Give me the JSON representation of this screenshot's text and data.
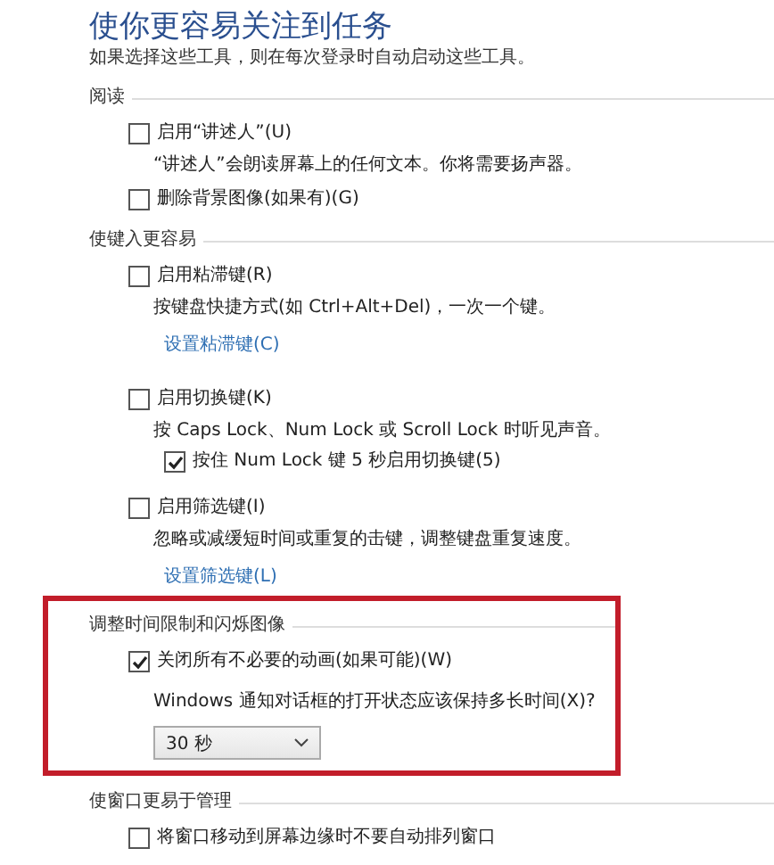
{
  "header": {
    "title": "使你更容易关注到任务",
    "subtitle": "如果选择这些工具，则在每次登录时自动启动这些工具。"
  },
  "sections": [
    {
      "heading": "阅读",
      "highlighted": false,
      "items": [
        {
          "kind": "checkbox",
          "label": "启用“讲述人”(U)",
          "checked": false
        },
        {
          "kind": "description",
          "text": "“讲述人”会朗读屏幕上的任何文本。你将需要扬声器。"
        },
        {
          "kind": "checkbox",
          "label": "删除背景图像(如果有)(G)",
          "checked": false
        }
      ]
    },
    {
      "heading": "使键入更容易",
      "highlighted": false,
      "items": [
        {
          "kind": "checkbox",
          "label": "启用粘滞键(R)",
          "checked": false
        },
        {
          "kind": "description",
          "text": "按键盘快捷方式(如 Ctrl+Alt+Del)，一次一个键。"
        },
        {
          "kind": "link",
          "text": "设置粘滞键(C)"
        },
        {
          "kind": "checkbox",
          "label": "启用切换键(K)",
          "checked": false
        },
        {
          "kind": "description",
          "text": "按 Caps Lock、Num Lock 或 Scroll Lock 时听见声音。"
        },
        {
          "kind": "subcheckbox",
          "label": "按住 Num Lock 键 5 秒启用切换键(5)",
          "checked": true
        },
        {
          "kind": "checkbox",
          "label": "启用筛选键(I)",
          "checked": false
        },
        {
          "kind": "description",
          "text": "忽略或减缓短时间或重复的击键，调整键盘重复速度。"
        },
        {
          "kind": "link",
          "text": "设置筛选键(L)"
        }
      ]
    },
    {
      "heading": "调整时间限制和闪烁图像",
      "highlighted": true,
      "items": [
        {
          "kind": "checkbox",
          "label": "关闭所有不必要的动画(如果可能)(W)",
          "checked": true
        },
        {
          "kind": "question",
          "text": "Windows 通知对话框的打开状态应该保持多长时间(X)?"
        },
        {
          "kind": "select",
          "value": "30 秒"
        }
      ]
    },
    {
      "heading": "使窗口更易于管理",
      "highlighted": false,
      "items": [
        {
          "kind": "checkbox",
          "label": "将窗口移动到屏幕边缘时不要自动排列窗口",
          "checked": false
        }
      ]
    }
  ]
}
